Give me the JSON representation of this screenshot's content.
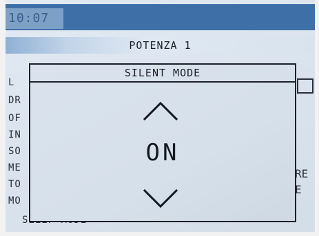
{
  "status_bar": {
    "time": "10:07"
  },
  "header": {
    "title": "POTENZA 1"
  },
  "background_menu": {
    "items": [
      "L",
      "DR",
      "OF",
      "IN",
      "SO",
      "ME",
      "TO",
      "MO",
      "SLEEP MODE"
    ],
    "right_fragments": [
      "RE",
      "E"
    ]
  },
  "dialog": {
    "title": "SILENT MODE",
    "value": "ON",
    "up_icon": "chevron-up-icon",
    "down_icon": "chevron-down-icon"
  },
  "colors": {
    "top_bar": "#3f6fa7",
    "clock_bg": "#7da0c6",
    "screen_bg": "#dbe4ee",
    "border": "#1c2028"
  }
}
